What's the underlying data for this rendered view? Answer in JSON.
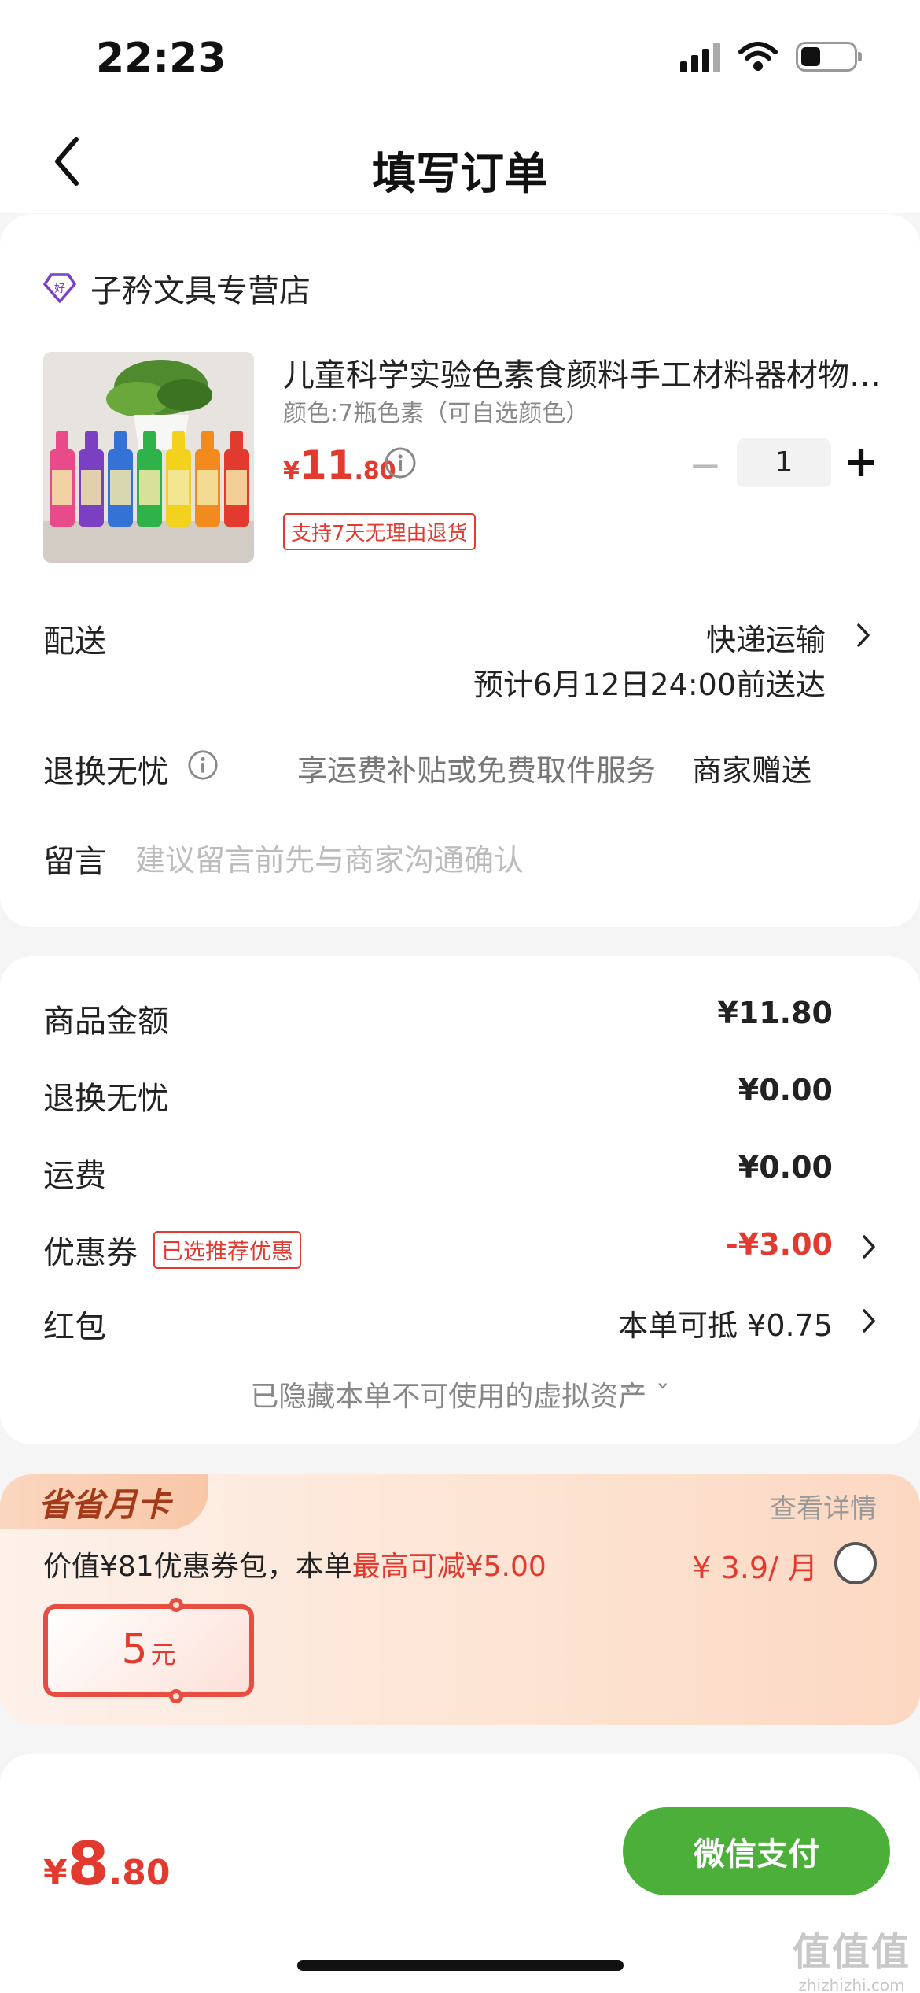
{
  "status_bar": {
    "time": "22:23"
  },
  "nav": {
    "title": "填写订单"
  },
  "shop": {
    "name": "子矜文具专营店"
  },
  "product": {
    "title": "儿童科学实验色素食颜料手工材料器材物理化学",
    "spec": "颜色:7瓶色素（可自选颜色）",
    "price_yen": "¥",
    "price_int": "11",
    "price_dec": ".80",
    "quantity": "1",
    "return_badge": "支持7天无理由退货",
    "bottle_colors": [
      "#e84a8a",
      "#7b3fc4",
      "#3572d6",
      "#2fb24a",
      "#f2d21d",
      "#f28a1d",
      "#e23a2f"
    ]
  },
  "delivery": {
    "label": "配送",
    "method": "快递运输",
    "estimate": "预计6月12日24:00前送达"
  },
  "return_service": {
    "label": "退换无忧",
    "desc": "享运费补贴或免费取件服务",
    "gift": "商家赠送"
  },
  "message": {
    "label": "留言",
    "placeholder": "建议留言前先与商家沟通确认"
  },
  "price_summary": {
    "goods_label": "商品金额",
    "goods_value": "¥11.80",
    "return_label": "退换无忧",
    "return_value": "¥0.00",
    "shipping_label": "运费",
    "shipping_value": "¥0.00",
    "coupon_label": "优惠券",
    "coupon_badge": "已选推荐优惠",
    "coupon_value": "-¥3.00",
    "redpacket_label": "红包",
    "redpacket_value": "本单可抵 ¥0.75",
    "hidden_assets": "已隐藏本单不可使用的虚拟资产 ˇ"
  },
  "member_card": {
    "tag": "省省月卡",
    "detail": "查看详情",
    "desc_prefix": "价值¥81优惠券包，本单",
    "desc_highlight": "最高可减¥5.00",
    "price": "¥ 3.9/ 月",
    "coupon_amount": "5",
    "coupon_unit": "元"
  },
  "checkout": {
    "total_yen": "¥",
    "total_int": "8",
    "total_dec": ".80",
    "pay_label": "微信支付"
  },
  "watermark": {
    "line1": "值值值",
    "line2": "zhizhizhi.com"
  },
  "colors": {
    "accent_red": "#e23a2f",
    "pay_green": "#4caf3a",
    "shop_icon_purple": "#7a3fc4"
  }
}
